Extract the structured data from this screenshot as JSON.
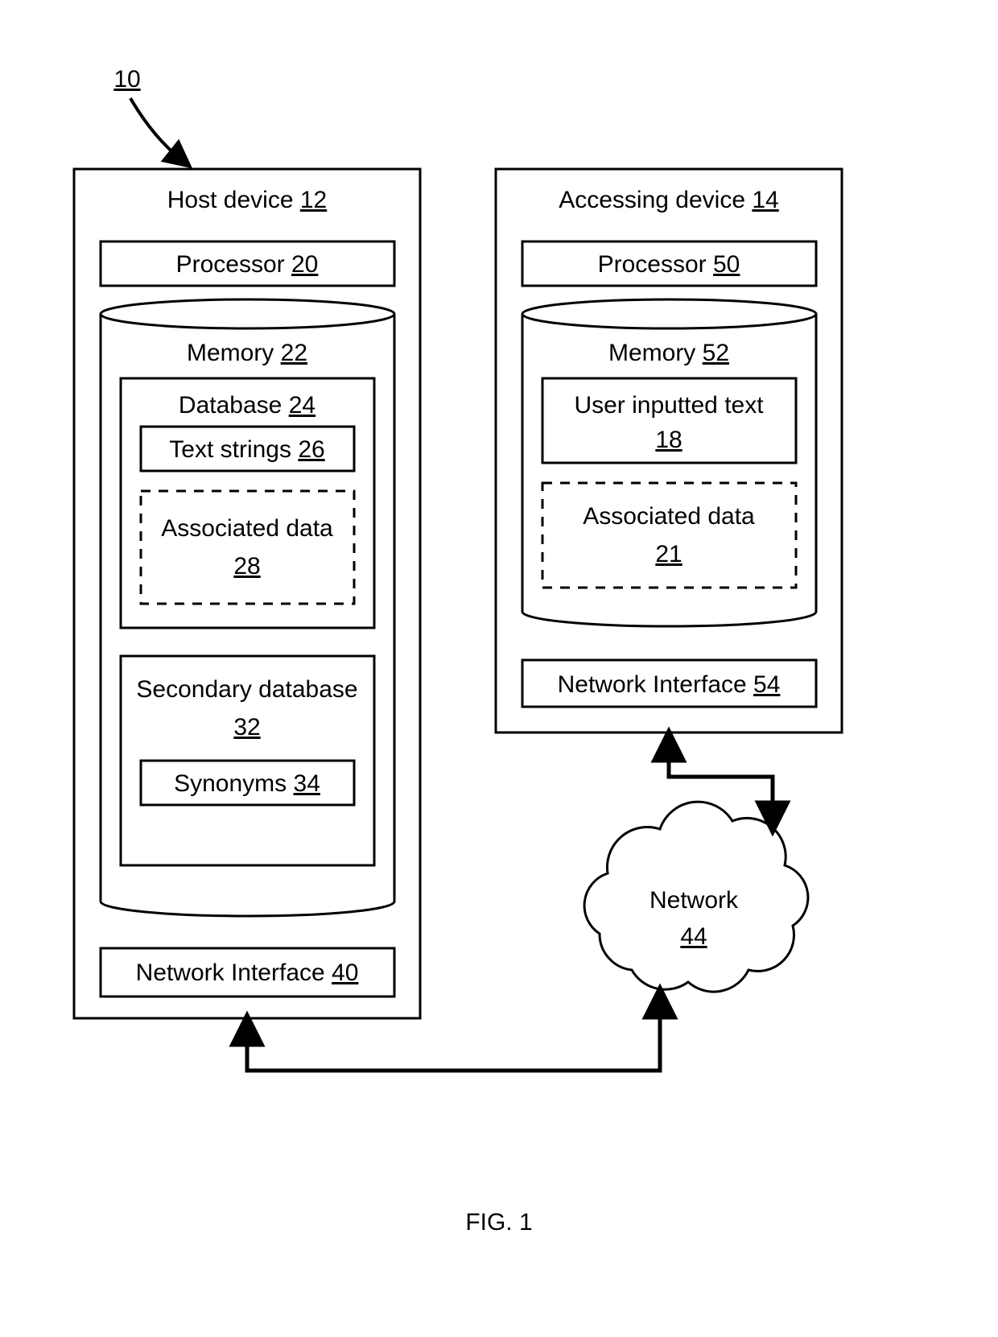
{
  "figureRef": {
    "label": "10"
  },
  "host": {
    "title": "Host device",
    "ref": "12",
    "processor": {
      "label": "Processor",
      "ref": "20"
    },
    "memory": {
      "label": "Memory",
      "ref": "22",
      "database": {
        "label": "Database",
        "ref": "24",
        "textStrings": {
          "label": "Text strings",
          "ref": "26"
        },
        "associatedData": {
          "label": "Associated data",
          "ref": "28"
        }
      },
      "secondaryDatabase": {
        "label": "Secondary database",
        "ref": "32",
        "synonyms": {
          "label": "Synonyms",
          "ref": "34"
        }
      }
    },
    "networkInterface": {
      "label": "Network Interface",
      "ref": "40"
    }
  },
  "accessing": {
    "title": "Accessing device",
    "ref": "14",
    "processor": {
      "label": "Processor",
      "ref": "50"
    },
    "memory": {
      "label": "Memory",
      "ref": "52",
      "userText": {
        "label": "User inputted text",
        "ref": "18"
      },
      "associatedData": {
        "label": "Associated data",
        "ref": "21"
      }
    },
    "networkInterface": {
      "label": "Network Interface",
      "ref": "54"
    }
  },
  "network": {
    "label": "Network",
    "ref": "44"
  },
  "caption": "FIG. 1"
}
